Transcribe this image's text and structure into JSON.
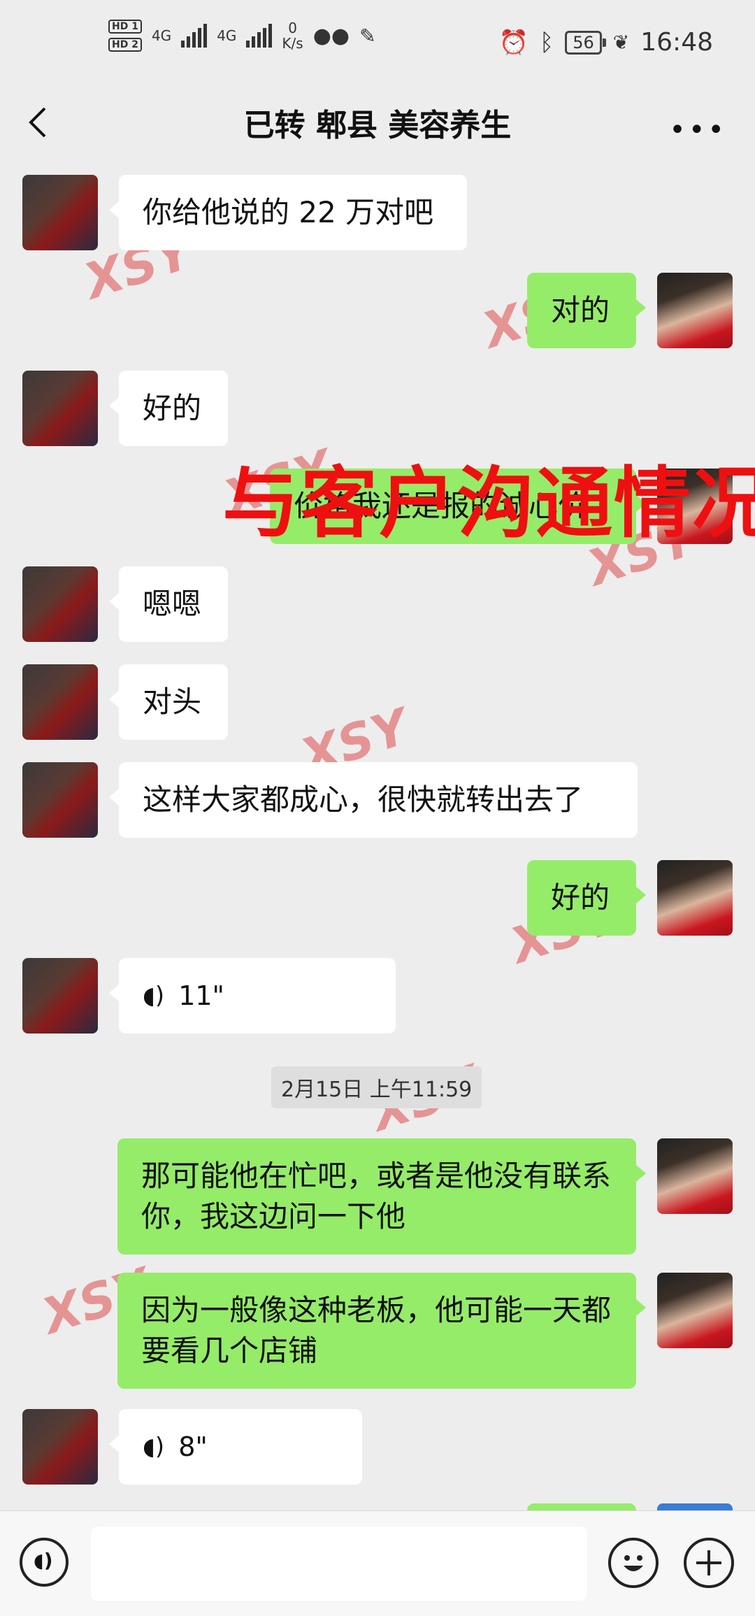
{
  "status_bar": {
    "hd1": "HD 1",
    "hd2": "HD 2",
    "net1": "4G",
    "net2": "4G",
    "speed_value": "0",
    "speed_unit": "K/s",
    "battery": "56",
    "time": "16:48"
  },
  "header": {
    "title": "已转 郫县 美容养生"
  },
  "messages": [
    {
      "side": "left",
      "text": "你给他说的 22 万对吧"
    },
    {
      "side": "right",
      "text": "对的"
    },
    {
      "side": "left",
      "text": "好的"
    },
    {
      "side": "right",
      "text": "价格我还是报的诚心价"
    },
    {
      "side": "left",
      "text": "嗯嗯"
    },
    {
      "side": "left",
      "text": "对头"
    },
    {
      "side": "left",
      "text": "这样大家都成心，很快就转出去了"
    },
    {
      "side": "right",
      "text": "好的"
    },
    {
      "side": "left",
      "voice": "11\""
    },
    {
      "side": "right",
      "text": "那可能他在忙吧，或者是他没有联系你，我这边问一下他"
    },
    {
      "side": "right",
      "text": "因为一般像这种老板，他可能一天都要看几个店铺"
    },
    {
      "side": "left",
      "voice": "8\""
    }
  ],
  "timestamp": "2月15日 上午11:59",
  "overlay_caption": "与客户沟通情况",
  "watermark": "XSY",
  "colors": {
    "sent_bubble": "#95ec69",
    "received_bubble": "#ffffff",
    "overlay_text": "#ee1010"
  }
}
